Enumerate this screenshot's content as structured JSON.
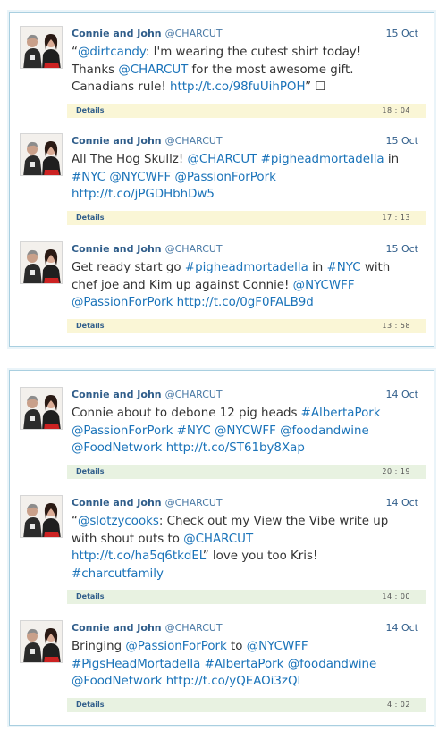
{
  "panels": [
    {
      "tweets": [
        {
          "author": "Connie and John",
          "handle": "@CHARCUT",
          "date": "15 Oct",
          "lines": [
            [
              {
                "t": "“"
              },
              {
                "t": "@dirtcandy",
                "link": true
              },
              {
                "t": ": I'm wearing the cutest shirt today!"
              }
            ],
            [
              {
                "t": "Thanks "
              },
              {
                "t": "@CHARCUT",
                "link": true
              },
              {
                "t": " for the most awesome gift."
              }
            ],
            [
              {
                "t": "Canadians rule! "
              },
              {
                "t": "http://t.co/98fuUihPOH",
                "link": true
              },
              {
                "t": "” ☐"
              }
            ]
          ],
          "details_label": "Details",
          "time": "18 : 04"
        },
        {
          "author": "Connie and John",
          "handle": "@CHARCUT",
          "date": "15 Oct",
          "lines": [
            [
              {
                "t": "All The Hog Skullz! "
              },
              {
                "t": "@CHARCUT",
                "link": true
              },
              {
                "t": " "
              },
              {
                "t": "#pigheadmortadella",
                "link": true
              },
              {
                "t": " in"
              }
            ],
            [
              {
                "t": "#NYC",
                "link": true
              },
              {
                "t": " "
              },
              {
                "t": "@NYCWFF",
                "link": true
              },
              {
                "t": " "
              },
              {
                "t": "@PassionForPork",
                "link": true
              }
            ],
            [
              {
                "t": "http://t.co/jPGDHbhDw5",
                "link": true
              }
            ]
          ],
          "details_label": "Details",
          "time": "17 : 13"
        },
        {
          "author": "Connie and John",
          "handle": "@CHARCUT",
          "date": "15 Oct",
          "lines": [
            [
              {
                "t": "Get ready start go "
              },
              {
                "t": "#pigheadmortadella",
                "link": true
              },
              {
                "t": " in "
              },
              {
                "t": "#NYC",
                "link": true
              },
              {
                "t": " with"
              }
            ],
            [
              {
                "t": "chef joe and Kim up against Connie! "
              },
              {
                "t": "@NYCWFF",
                "link": true
              }
            ],
            [
              {
                "t": "@PassionForPork",
                "link": true
              },
              {
                "t": " "
              },
              {
                "t": "http://t.co/0gF0FALB9d",
                "link": true
              }
            ]
          ],
          "details_label": "Details",
          "time": "13 : 58"
        }
      ]
    },
    {
      "tweets": [
        {
          "author": "Connie and John",
          "handle": "@CHARCUT",
          "date": "14 Oct",
          "lines": [
            [
              {
                "t": "Connie about to debone 12 pig heads "
              },
              {
                "t": "#AlbertaPork",
                "link": true
              }
            ],
            [
              {
                "t": "@PassionForPork",
                "link": true
              },
              {
                "t": " "
              },
              {
                "t": "#NYC",
                "link": true
              },
              {
                "t": " "
              },
              {
                "t": "@NYCWFF",
                "link": true
              },
              {
                "t": " "
              },
              {
                "t": "@foodandwine",
                "link": true
              }
            ],
            [
              {
                "t": "@FoodNetwork",
                "link": true
              },
              {
                "t": " "
              },
              {
                "t": "http://t.co/ST61by8Xap",
                "link": true
              }
            ]
          ],
          "details_label": "Details",
          "time": "20 : 19"
        },
        {
          "author": "Connie and John",
          "handle": "@CHARCUT",
          "date": "14 Oct",
          "lines": [
            [
              {
                "t": "“"
              },
              {
                "t": "@slotzycooks",
                "link": true
              },
              {
                "t": ": Check out my View the Vibe write up"
              }
            ],
            [
              {
                "t": "with shout outs to "
              },
              {
                "t": "@CHARCUT",
                "link": true
              }
            ],
            [
              {
                "t": "http://t.co/ha5q6tkdEL",
                "link": true
              },
              {
                "t": "” love you too Kris!"
              }
            ],
            [
              {
                "t": "#charcutfamily",
                "link": true
              }
            ]
          ],
          "details_label": "Details",
          "time": "14 : 00"
        },
        {
          "author": "Connie and John",
          "handle": "@CHARCUT",
          "date": "14 Oct",
          "lines": [
            [
              {
                "t": "Bringing "
              },
              {
                "t": "@PassionForPork",
                "link": true
              },
              {
                "t": " to "
              },
              {
                "t": "@NYCWFF",
                "link": true
              }
            ],
            [
              {
                "t": "#PigsHeadMortadella",
                "link": true
              },
              {
                "t": " "
              },
              {
                "t": "#AlbertaPork",
                "link": true
              },
              {
                "t": " "
              },
              {
                "t": "@foodandwine",
                "link": true
              }
            ],
            [
              {
                "t": "@FoodNetwork",
                "link": true
              },
              {
                "t": " "
              },
              {
                "t": "http://t.co/yQEAOi3zQl",
                "link": true
              }
            ]
          ],
          "details_label": "Details",
          "time": "4 : 02"
        }
      ]
    }
  ]
}
